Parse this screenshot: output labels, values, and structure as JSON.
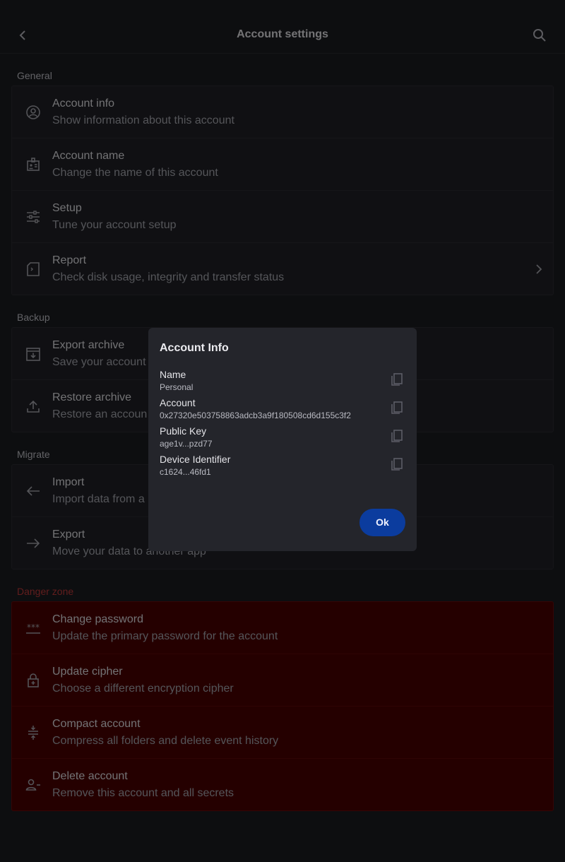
{
  "header": {
    "title": "Account settings"
  },
  "sections": {
    "general": {
      "label": "General"
    },
    "backup": {
      "label": "Backup"
    },
    "migrate": {
      "label": "Migrate"
    },
    "danger": {
      "label": "Danger zone"
    }
  },
  "items": {
    "account_info": {
      "title": "Account info",
      "subtitle": "Show information about this account",
      "icon": "account-circle-icon"
    },
    "account_name": {
      "title": "Account name",
      "subtitle": "Change the name of this account",
      "icon": "badge-icon"
    },
    "setup": {
      "title": "Setup",
      "subtitle": "Tune your account setup",
      "icon": "tune-icon"
    },
    "report": {
      "title": "Report",
      "subtitle": "Check disk usage, integrity and transfer status",
      "icon": "report-icon"
    },
    "export_archive": {
      "title": "Export archive",
      "subtitle": "Save your account",
      "icon": "archive-icon"
    },
    "restore_archive": {
      "title": "Restore archive",
      "subtitle": "Restore an accoun",
      "icon": "upload-icon"
    },
    "import": {
      "title": "Import",
      "subtitle": "Import data from a",
      "icon": "arrow-left-icon"
    },
    "export": {
      "title": "Export",
      "subtitle": "Move your data to another app",
      "icon": "arrow-right-icon"
    },
    "change_password": {
      "title": "Change password",
      "subtitle": "Update the primary password for the account",
      "icon": "password-icon"
    },
    "update_cipher": {
      "title": "Update cipher",
      "subtitle": "Choose a different encryption cipher",
      "icon": "lock-plus-icon"
    },
    "compact_account": {
      "title": "Compact account",
      "subtitle": "Compress all folders and delete event history",
      "icon": "compress-icon"
    },
    "delete_account": {
      "title": "Delete account",
      "subtitle": "Remove this account and all secrets",
      "icon": "person-remove-icon"
    }
  },
  "dialog": {
    "title": "Account Info",
    "fields": [
      {
        "label": "Name",
        "value": "Personal"
      },
      {
        "label": "Account",
        "value": "0x27320e503758863adcb3a9f180508cd6d155c3f2"
      },
      {
        "label": "Public Key",
        "value": "age1v...pzd77"
      },
      {
        "label": "Device Identifier",
        "value": "c1624...46fd1"
      }
    ],
    "ok_label": "Ok"
  },
  "colors": {
    "background": "#1b1c21",
    "danger_bg": "#4a0000",
    "danger_label": "#c23a3a",
    "primary_button": "#0b3c9e"
  }
}
